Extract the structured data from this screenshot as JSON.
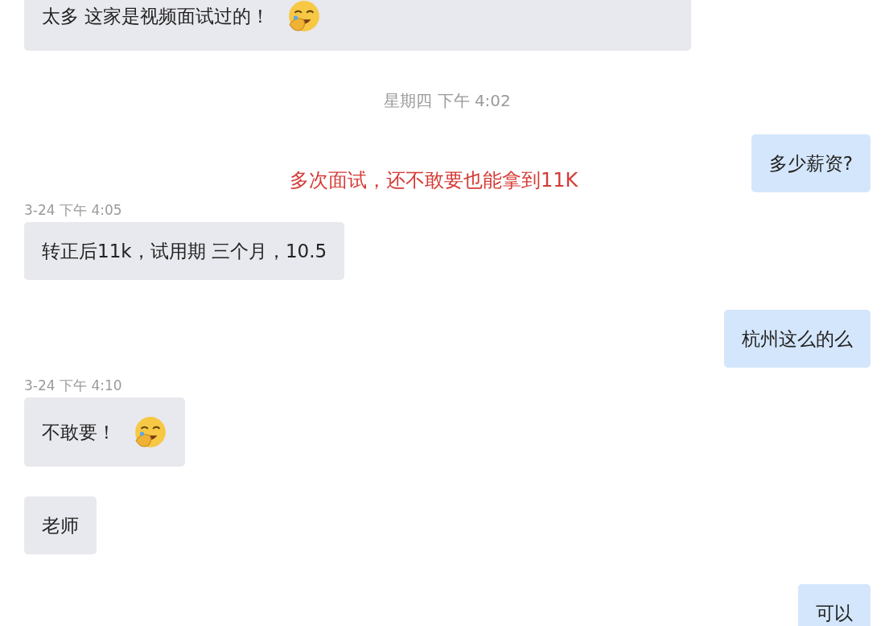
{
  "messages": [
    {
      "kind": "incoming",
      "text": "太多 这家是视频面试过的！",
      "emoji": true
    },
    {
      "kind": "timestamp_center",
      "text": "星期四 下午 4:02"
    },
    {
      "kind": "outgoing",
      "text": "多少薪资?",
      "emoji": false
    },
    {
      "kind": "timestamp_side",
      "text": "3-24 下午 4:05"
    },
    {
      "kind": "incoming",
      "text": "转正后11k，试用期 三个月，10.5",
      "emoji": false
    },
    {
      "kind": "outgoing",
      "text": "杭州这么的么",
      "emoji": false
    },
    {
      "kind": "timestamp_side",
      "text": "3-24 下午 4:10"
    },
    {
      "kind": "incoming",
      "text": "不敢要！",
      "emoji": true
    },
    {
      "kind": "incoming",
      "text": "老师",
      "emoji": false
    },
    {
      "kind": "outgoing",
      "text": "可以",
      "emoji": false
    }
  ],
  "annotation": "多次面试，还不敢要也能拿到11K"
}
